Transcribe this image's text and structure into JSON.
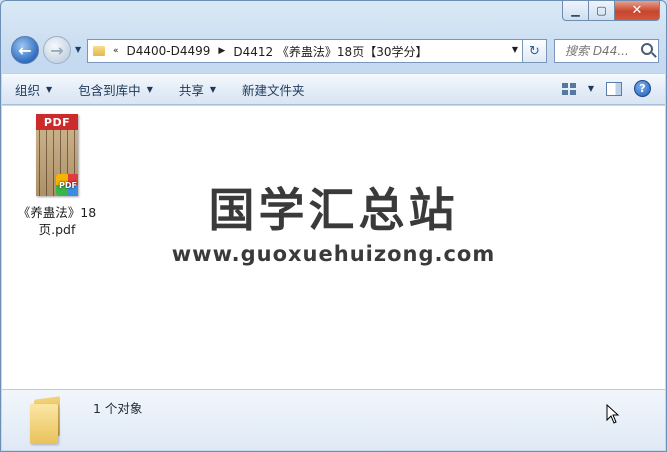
{
  "address": {
    "overflow": "«",
    "crumbs": [
      "D4400-D4499",
      "D4412 《养蛊法》18页【30学分】"
    ]
  },
  "search": {
    "placeholder": "搜索 D44..."
  },
  "toolbar": {
    "organize": "组织",
    "include_library": "包含到库中",
    "share": "共享",
    "new_folder": "新建文件夹"
  },
  "file": {
    "name": "《养蛊法》18页.pdf",
    "thumb_badge": "PDF",
    "type_badge": "PDF"
  },
  "watermark": {
    "cn": "国学汇总站",
    "url": "www.guoxuehuizong.com"
  },
  "details": {
    "count": "1 个对象"
  },
  "icons": {
    "back": "back-arrow-icon",
    "forward": "forward-arrow-icon",
    "refresh": "refresh-icon",
    "search": "search-icon",
    "help": "help-icon"
  },
  "colors": {
    "pdf_red": "#cc2b2b",
    "close_red": "#c7452d",
    "accent_blue": "#2f6cc1"
  }
}
